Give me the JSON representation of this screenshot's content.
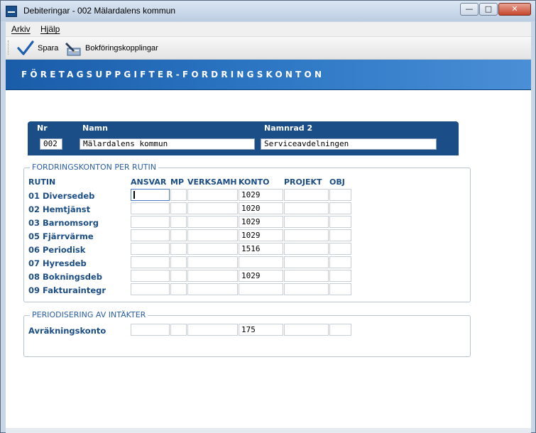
{
  "window": {
    "title": "Debiteringar  -  002 Mälardalens kommun",
    "controls": {
      "minimize": "—",
      "maximize": "□",
      "close": "✕"
    }
  },
  "menu": [
    "Arkiv",
    "Hjälp"
  ],
  "toolbar": {
    "save_label": "Spara",
    "save_icon": "checkmark-icon",
    "accounting_label": "Bokföringskopplingar",
    "accounting_icon": "pen-ledger-icon"
  },
  "banner": {
    "title": "FÖRETAGSUPPGIFTER-FORDRINGSKONTON"
  },
  "header": {
    "col_nr": "Nr",
    "col_namn": "Namn",
    "col_namnrad2": "Namnrad 2",
    "nr": "002",
    "namn": "Mälardalens kommun",
    "namnrad2": "Serviceavdelningen"
  },
  "receivables": {
    "legend": "FORDRINGSKONTON PER RUTIN",
    "columns": [
      "RUTIN",
      "ANSVAR",
      "MP",
      "VERKSAMH",
      "KONTO",
      "PROJEKT",
      "OBJ"
    ],
    "rows": [
      {
        "rutin": "01 Diversedeb",
        "ansvar": "",
        "mp": "",
        "verksamh": "",
        "konto": "1029",
        "projekt": "",
        "obj": ""
      },
      {
        "rutin": "02 Hemtjänst",
        "ansvar": "",
        "mp": "",
        "verksamh": "",
        "konto": "1020",
        "projekt": "",
        "obj": ""
      },
      {
        "rutin": "03 Barnomsorg",
        "ansvar": "",
        "mp": "",
        "verksamh": "",
        "konto": "1029",
        "projekt": "",
        "obj": ""
      },
      {
        "rutin": "05 Fjärrvärme",
        "ansvar": "",
        "mp": "",
        "verksamh": "",
        "konto": "1029",
        "projekt": "",
        "obj": ""
      },
      {
        "rutin": "06 Periodisk",
        "ansvar": "",
        "mp": "",
        "verksamh": "",
        "konto": "1516",
        "projekt": "",
        "obj": ""
      },
      {
        "rutin": "07 Hyresdeb",
        "ansvar": "",
        "mp": "",
        "verksamh": "",
        "konto": "",
        "projekt": "",
        "obj": ""
      },
      {
        "rutin": "08 Bokningsdeb",
        "ansvar": "",
        "mp": "",
        "verksamh": "",
        "konto": "1029",
        "projekt": "",
        "obj": ""
      },
      {
        "rutin": "09 Fakturaintegr",
        "ansvar": "",
        "mp": "",
        "verksamh": "",
        "konto": "",
        "projekt": "",
        "obj": ""
      }
    ]
  },
  "accrual": {
    "legend": "PERIODISERING AV INTÄKTER",
    "row": {
      "label": "Avräkningskonto",
      "ansvar": "",
      "mp": "",
      "verksamh": "",
      "konto": "175",
      "projekt": "",
      "obj": ""
    }
  },
  "colors": {
    "accent": "#1b4d86",
    "legend": "#2a5ea3",
    "banner": "#1a5ca8"
  }
}
